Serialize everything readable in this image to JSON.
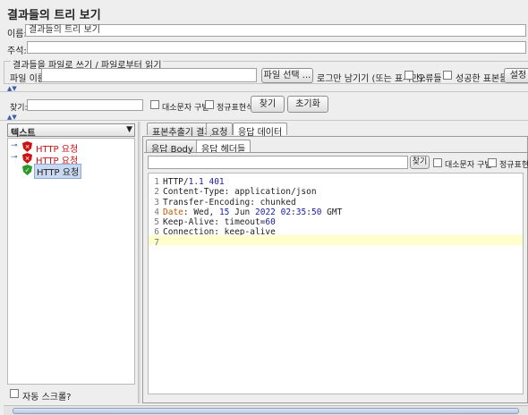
{
  "window": {
    "title": "결과들의 트리 보기"
  },
  "form": {
    "name_label": "이름:",
    "name_value": "결과들의 트리 보기",
    "comment_label": "주석:",
    "comment_value": "",
    "file_group_title": "결과들을 파일로 쓰기 / 파일로부터 읽기",
    "file_name_label": "파일 이름",
    "file_name_value": "",
    "file_select_button": "파일 선택 ...",
    "log_only_label": "로그만 남기기 (또는 표시만):",
    "errors_label": "오류들",
    "success_label": "성공한 표본들",
    "settings_button": "설정"
  },
  "search": {
    "label": "찾기:",
    "value": "",
    "case_label": "대소문자 구별",
    "regex_label": "정규표현식",
    "find_button": "찾기",
    "reset_button": "초기화"
  },
  "left_panel": {
    "renderer_select": "텍스트",
    "tree_items": [
      {
        "label": "HTTP 요청",
        "status": "error",
        "color": "#cc1111"
      },
      {
        "label": "HTTP 요청",
        "status": "error",
        "color": "#cc1111"
      },
      {
        "label": "HTTP 요청",
        "status": "success",
        "color": "#222222"
      }
    ],
    "auto_scroll_label": "자동 스크롤?"
  },
  "right_panel": {
    "tabs": [
      "표본추출기 결과",
      "요청",
      "응답 데이터"
    ],
    "active_tab": "응답 데이터",
    "subtabs": [
      "응답 Body",
      "응답 헤더들"
    ],
    "active_subtab": "응답 헤더들",
    "inner_search": {
      "value": "",
      "find_button": "찾기",
      "case_label": "대소문자 구별",
      "regex_label": "정규표현식"
    },
    "code_lines": [
      {
        "num": "1",
        "parts": [
          {
            "t": "HTTP/",
            "c": "#222"
          },
          {
            "t": "1.1 401",
            "c": "#1a1aa6"
          }
        ]
      },
      {
        "num": "2",
        "parts": [
          {
            "t": "Content-Type: application/json",
            "c": "#222"
          }
        ]
      },
      {
        "num": "3",
        "parts": [
          {
            "t": "Transfer-Encoding: chunked",
            "c": "#222"
          }
        ]
      },
      {
        "num": "4",
        "parts": [
          {
            "t": "Date",
            "c": "#c05800"
          },
          {
            "t": ": Wed, ",
            "c": "#222"
          },
          {
            "t": "15",
            "c": "#1a1aa6"
          },
          {
            "t": " Jun ",
            "c": "#222"
          },
          {
            "t": "2022 02",
            "c": "#1a1aa6"
          },
          {
            "t": ":",
            "c": "#222"
          },
          {
            "t": "35",
            "c": "#1a1aa6"
          },
          {
            "t": ":",
            "c": "#222"
          },
          {
            "t": "50",
            "c": "#1a1aa6"
          },
          {
            "t": " GMT",
            "c": "#222"
          }
        ]
      },
      {
        "num": "5",
        "parts": [
          {
            "t": "Keep-Alive: timeout=",
            "c": "#222"
          },
          {
            "t": "60",
            "c": "#1a1aa6"
          }
        ]
      },
      {
        "num": "6",
        "parts": [
          {
            "t": "Connection: keep-alive",
            "c": "#222"
          }
        ]
      },
      {
        "num": "7",
        "parts": []
      }
    ]
  },
  "colors": {
    "accent": "#3b5ea8",
    "highlight_line": "#ffffcc",
    "error": "#cc1111",
    "success": "#2a9a2a"
  }
}
